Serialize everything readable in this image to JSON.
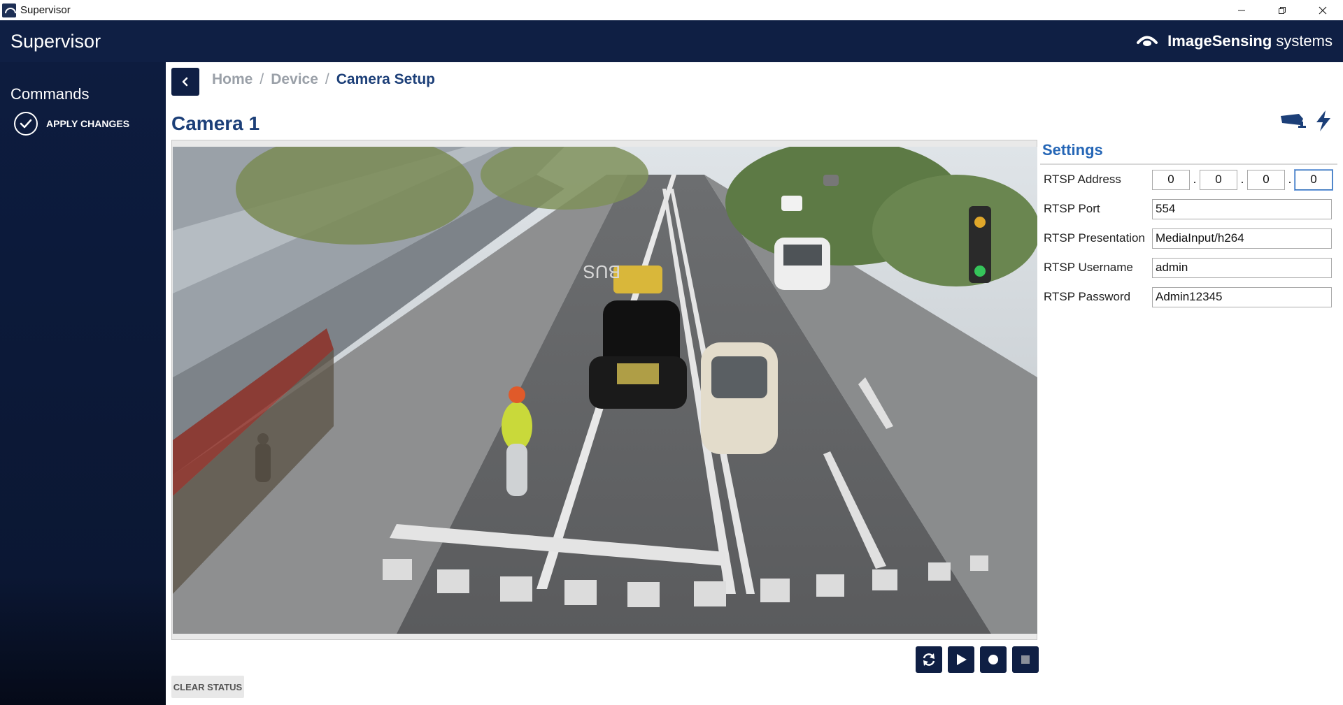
{
  "window": {
    "title": "Supervisor",
    "controls": [
      "minimize-icon",
      "restore-icon",
      "close-icon"
    ]
  },
  "header": {
    "app_name": "Supervisor",
    "brand_strong": "ImageSensing",
    "brand_light": "systems"
  },
  "sidebar": {
    "heading": "Commands",
    "items": [
      {
        "label": "APPLY CHANGES",
        "icon": "check-circle-icon"
      }
    ]
  },
  "breadcrumb": {
    "items": [
      "Home",
      "Device",
      "Camera Setup"
    ],
    "separator": "/"
  },
  "camera": {
    "title": "Camera 1",
    "video_description_icon": "camera-feed",
    "controls": [
      "refresh-icon",
      "play-icon",
      "record-icon",
      "stop-icon"
    ]
  },
  "status": {
    "clear_label": "CLEAR STATUS"
  },
  "settings": {
    "title": "Settings",
    "rtsp_address_label": "RTSP Address",
    "rtsp_address": [
      "0",
      "0",
      "0",
      "0"
    ],
    "rtsp_port_label": "RTSP Port",
    "rtsp_port": "554",
    "rtsp_presentation_label": "RTSP Presentation",
    "rtsp_presentation": "MediaInput/h264",
    "rtsp_username_label": "RTSP Username",
    "rtsp_username": "admin",
    "rtsp_password_label": "RTSP Password",
    "rtsp_password": "Admin12345"
  },
  "colors": {
    "navy": "#0f1f44",
    "title_blue": "#1c3f78",
    "settings_blue": "#2566b6"
  }
}
